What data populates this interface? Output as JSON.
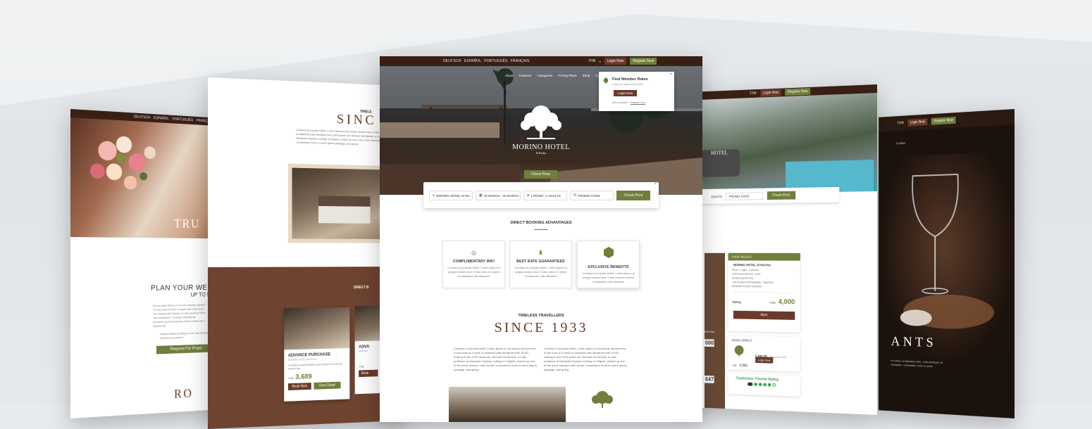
{
  "colors": {
    "brown": "#5a2f1f",
    "olive": "#6f7f3c",
    "dark": "#2a1a12",
    "accent_brown": "#7a4a34"
  },
  "center": {
    "languages": [
      "DEUTSCH",
      "ESPAÑOL",
      "PORTUGUÊS",
      "FRANÇAIS"
    ],
    "currency": "THB",
    "login_label": "Login Now",
    "register_label": "Register Now",
    "nav": [
      "About",
      "Features",
      "Categories",
      "Pricing Plans",
      "Shop",
      "Contact"
    ],
    "logo_name": "MORINO HOTEL",
    "logo_sub": "Si Racha",
    "check_price_hero": "Check Price",
    "popup": {
      "title": "Find Member Rates",
      "sub": "Log in to save extra 10%",
      "button": "Login Now",
      "note": "Not a member ?",
      "note_link": "Register Now"
    },
    "booking": {
      "hotel": "MORINO HOTEL SI RA..",
      "dates": "19 MARCH - 20 MARCH",
      "rooms": "1 ROOM , 2 ADULTS",
      "promo": "PROMO CODE",
      "button": "Check Price"
    },
    "advantages_title": "DIRECT BOOKING ADVANTAGES",
    "cards": [
      {
        "title": "COMPLIMENTARY WIFI",
        "text": "Contrary to popular belief, Lorem Ipsum is simply random text. It has roots in a piece of classical Latin literature",
        "icon": "wifi-icon"
      },
      {
        "title": "BEST RATE GUARANTEED",
        "text": "Contrary to popular belief, Lorem Ipsum is simply random text. It has roots in a piece of classical Latin literature",
        "icon": "tag-icon"
      },
      {
        "title": "EXCLUSIVE BENEFITS",
        "text": "Contrary to popular belief, Lorem Ipsum is simply random text. It has roots in a piece of classical Latin literature",
        "icon": "benefits-icon"
      }
    ],
    "timeless_label": "TIMELESS TRAVELLERS",
    "since": "SINCE 1933",
    "para1": "Contrary to popular belief, Lorem Ipsum is not simply random text. It has roots in a piece of classical Latin literature from 45 BC, making it over 2000 years old. Richard McClintock, a Latin professor at Hampden-Sydney College in Virginia, looked up one of the more obscure Latin words, consectetur, from a Lorem Ipsum passage, and going",
    "para2": "Contrary to popular belief, Lorem Ipsum is not simply random text. It has roots in a piece of classical Latin literature from 45 BC, making it over 2000 years old. Richard McClintock, a Latin professor at Hampden-Sydney College in Virginia, looked up one of the more obscure Latin words, consectetur, from a Lorem Ipsum passage, and going"
  },
  "left1": {
    "languages": [
      "DEUTSCH",
      "ESPAÑOL",
      "PORTUGUÊS",
      "FRANÇAIS"
    ],
    "hero_word": "TRU",
    "plan_title": "PLAN YOUR WEDD",
    "plan_sub": "UP TO 5",
    "body": "Do you take Morino to be your fantasy partner? To have and to hold. To share with 2000 years old. Richard McClintock, a Latin professor filled with excitement. Through celebrations, Romance and ceremonies, wait to create your special day.",
    "body2": "Explore Radel wedding venues and dreams, and find your perfect",
    "button": "Request For Propo",
    "bottom_word": "RO"
  },
  "left2": {
    "timeless": "TIMELE",
    "since": "SINC",
    "para": "Contrary to popular belief, Lorem Ipsum is not simply random text. It has roots in a piece of classical Latin literature over 2000 years old. Richard McClintock, a Latin professor at Hampden-Sydney College in Virginia, looked up one of the more obscure Latin words, consectetur, from a Lorem Ipsum passage, and going",
    "direct_label": "DIRECT B",
    "room1": {
      "title": "ADVANCE PURCHASE",
      "sub": "MORINO HOTEL SIRACHA",
      "text": "Contrary to popular belief, Lorem Ipsum is not simply random text.",
      "currency": "THB",
      "price": "3,689",
      "book": "Book Now",
      "details": "View Detail"
    },
    "room2": {
      "title": "ADVA",
      "sub": "MORINO",
      "currency": "THB",
      "book": "Book"
    }
  },
  "right1": {
    "currency": "THB",
    "login_label": "Login Now",
    "register_label": "Register Now",
    "adults": "ADULTS",
    "promo": "PROMO CODE",
    "button": "Check Price",
    "logo_name": "HOTEL",
    "select_label": "YOUR SELECT",
    "hotel": "MORINO HOTEL SI RACHA",
    "details": [
      "Room : 1 night , 2 persons",
      "SUPERIOR WORLD - KING",
      "Booking options: Any",
      "Thai Resident with Breakfast - Stay/Pay2",
      "Breakfast included: Breakfast"
    ],
    "total_label": "TOTAL",
    "total_currency": "THB",
    "total_value": "4,000",
    "next": "Next",
    "book_direct": "BOOK DIRECT",
    "login_in": "Log in",
    "discount": "Discount 10%",
    "small_price": "4,000",
    "small_currency": "THB",
    "login_btn": "Login Now",
    "tripadvisor": "TripAdvisor Traveler Rating",
    "rating": 4.5,
    "edge_text": [
      "000",
      "647"
    ],
    "book_now": "Book Now"
  },
  "right2": {
    "currency": "THB",
    "login_label": "Login Now",
    "register_label": "Register Now",
    "nav": "Contact",
    "title": "ANTS",
    "para": "in a piece of classical Latin , Latin professor at Hampden- consectetur, from a Lorem"
  }
}
